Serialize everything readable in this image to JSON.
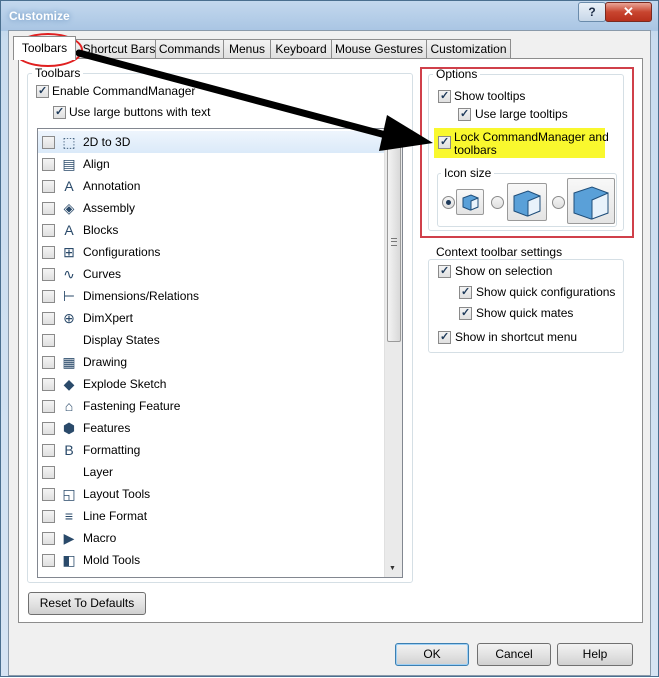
{
  "window": {
    "title": "Customize"
  },
  "titlebar": {
    "help_label": "?",
    "close_label": "✕"
  },
  "tabs": [
    "Toolbars",
    "Shortcut Bars",
    "Commands",
    "Menus",
    "Keyboard",
    "Mouse Gestures",
    "Customization"
  ],
  "active_tab": "Toolbars",
  "toolbars_group": {
    "legend": "Toolbars",
    "enable_commandmanager": {
      "label": "Enable CommandManager",
      "checked": true
    },
    "use_large_buttons": {
      "label": "Use large buttons with text",
      "checked": true
    },
    "items": [
      {
        "label": "2D to 3D",
        "icon": "2d-to-3d-icon",
        "checked": false,
        "selected": true
      },
      {
        "label": "Align",
        "icon": "align-icon",
        "checked": false
      },
      {
        "label": "Annotation",
        "icon": "annotation-icon",
        "checked": false
      },
      {
        "label": "Assembly",
        "icon": "assembly-icon",
        "checked": false
      },
      {
        "label": "Blocks",
        "icon": "blocks-icon",
        "checked": false
      },
      {
        "label": "Configurations",
        "icon": "configurations-icon",
        "checked": false
      },
      {
        "label": "Curves",
        "icon": "curves-icon",
        "checked": false
      },
      {
        "label": "Dimensions/Relations",
        "icon": "dimensions-icon",
        "checked": false
      },
      {
        "label": "DimXpert",
        "icon": "dimxpert-icon",
        "checked": false
      },
      {
        "label": "Display States",
        "icon": "",
        "checked": false
      },
      {
        "label": "Drawing",
        "icon": "drawing-icon",
        "checked": false
      },
      {
        "label": "Explode Sketch",
        "icon": "explode-sketch-icon",
        "checked": false
      },
      {
        "label": "Fastening Feature",
        "icon": "fastening-feature-icon",
        "checked": false
      },
      {
        "label": "Features",
        "icon": "features-icon",
        "checked": false
      },
      {
        "label": "Formatting",
        "icon": "formatting-icon",
        "checked": false
      },
      {
        "label": "Layer",
        "icon": "",
        "checked": false
      },
      {
        "label": "Layout Tools",
        "icon": "layout-tools-icon",
        "checked": false
      },
      {
        "label": "Line Format",
        "icon": "line-format-icon",
        "checked": false
      },
      {
        "label": "Macro",
        "icon": "macro-icon",
        "checked": false
      },
      {
        "label": "Mold Tools",
        "icon": "mold-tools-icon",
        "checked": false
      }
    ]
  },
  "options_group": {
    "legend": "Options",
    "show_tooltips": {
      "label": "Show tooltips",
      "checked": true
    },
    "use_large_tooltips": {
      "label": "Use large tooltips",
      "checked": true
    },
    "lock_commandmanager": {
      "label_line1": "Lock CommandManager and",
      "label_line2": "toolbars",
      "checked": true,
      "highlight": "#f9f82e"
    },
    "icon_size": {
      "legend": "Icon size",
      "options": [
        "small",
        "medium",
        "large"
      ],
      "selected": "small"
    }
  },
  "context_group": {
    "legend": "Context toolbar settings",
    "show_on_selection": {
      "label": "Show on selection",
      "checked": true
    },
    "show_quick_configurations": {
      "label": "Show quick configurations",
      "checked": true
    },
    "show_quick_mates": {
      "label": "Show quick mates",
      "checked": true
    },
    "show_in_shortcut_menu": {
      "label": "Show in shortcut menu",
      "checked": true
    }
  },
  "buttons": {
    "reset": "Reset To Defaults",
    "ok": "OK",
    "cancel": "Cancel",
    "help": "Help"
  },
  "colors": {
    "annotation_red": "#d0404a",
    "annotation_arrow": "#000000",
    "selection": "#dbeaf9"
  }
}
